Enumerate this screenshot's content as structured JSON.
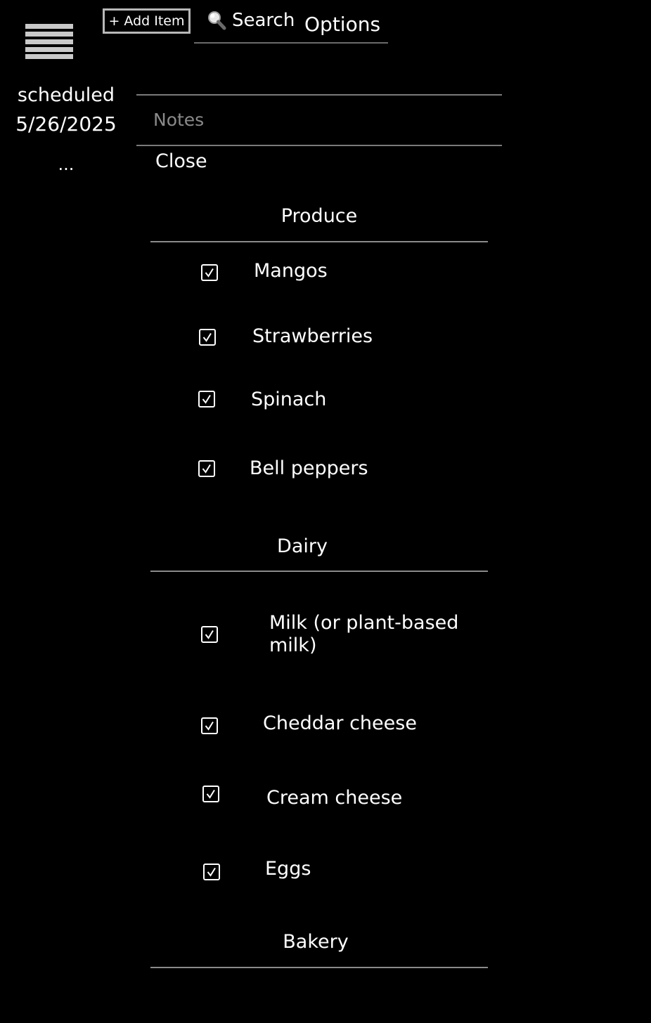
{
  "toolbar": {
    "add_label": "+ Add Item",
    "search_icon": "magnifier-icon",
    "search_label": "Search",
    "options_label": "Options",
    "menu_icon": "hamburger-icon"
  },
  "schedule": {
    "label": "scheduled",
    "date": "5/26/2025",
    "more": "..."
  },
  "notes": {
    "placeholder": "Notes",
    "value": ""
  },
  "close_label": "Close",
  "categories": [
    {
      "title": "Produce",
      "items": [
        {
          "label": "Mangos",
          "checked": true
        },
        {
          "label": "Strawberries",
          "checked": true
        },
        {
          "label": "Spinach",
          "checked": true
        },
        {
          "label": "Bell peppers",
          "checked": true
        }
      ]
    },
    {
      "title": "Dairy",
      "items": [
        {
          "label": "Milk (or plant-based milk)",
          "checked": true
        },
        {
          "label": "Cheddar cheese",
          "checked": true
        },
        {
          "label": "Cream cheese",
          "checked": true
        },
        {
          "label": "Eggs",
          "checked": true
        }
      ]
    },
    {
      "title": "Bakery",
      "items": []
    }
  ],
  "colors": {
    "background": "#000000",
    "text": "#ffffff",
    "rule": "#8a8a8a",
    "placeholder": "#8a8a8a"
  }
}
